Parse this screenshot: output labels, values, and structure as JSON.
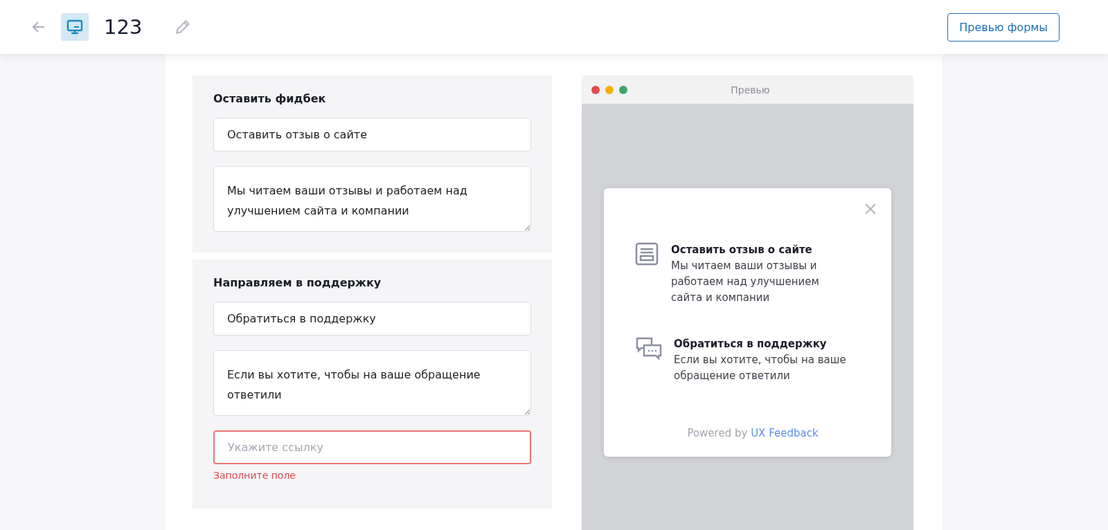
{
  "header": {
    "title": "123",
    "preview_button": "Превью формы"
  },
  "sections": [
    {
      "title": "Оставить фидбек",
      "fields": [
        {
          "kind": "input",
          "value": "Оставить отзыв о сайте"
        },
        {
          "kind": "textarea",
          "value": "Мы читаем ваши отзывы и работаем над улучшением сайта и компании"
        }
      ]
    },
    {
      "title": "Направляем в поддержку",
      "fields": [
        {
          "kind": "input",
          "value": "Обратиться в поддержку"
        },
        {
          "kind": "textarea",
          "value": "Если вы хотите, чтобы на ваше обращение ответили"
        },
        {
          "kind": "input",
          "placeholder": "Укажите ссылку",
          "error": "Заполните поле"
        }
      ]
    }
  ],
  "preview": {
    "window_title": "Превью",
    "items": [
      {
        "kind": "form",
        "title": "Оставить отзыв о сайте",
        "text": "Мы читаем ваши отзывы и работаем над улучшением сайта и компании"
      },
      {
        "kind": "chat",
        "title": "Обратиться в поддержку",
        "text": "Если вы хотите, чтобы на ваше обращение ответили"
      }
    ],
    "powered_by": "Powered by",
    "powered_link": "UX Feedback"
  }
}
